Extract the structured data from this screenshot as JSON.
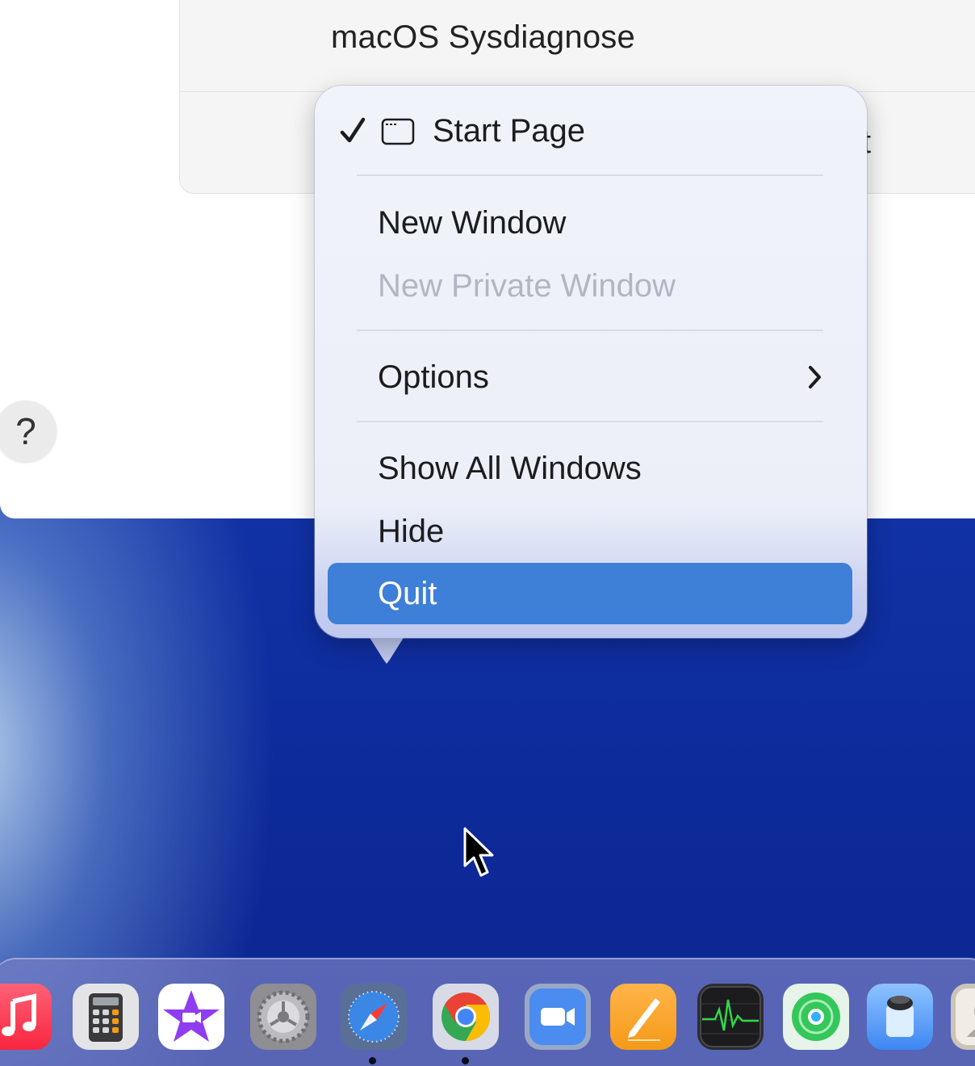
{
  "window": {
    "title": "macOS Sysdiagnose",
    "partial_text": "t",
    "help_label": "?"
  },
  "menu": {
    "start_page": {
      "label": "Start Page",
      "checked": true
    },
    "new_window": "New Window",
    "new_private_window": "New Private Window",
    "options": "Options",
    "show_all_windows": "Show All Windows",
    "hide": "Hide",
    "quit": "Quit"
  },
  "dock": {
    "apps": [
      {
        "name": "music-icon",
        "running": false
      },
      {
        "name": "calculator-icon",
        "running": false
      },
      {
        "name": "imovie-icon",
        "running": false
      },
      {
        "name": "system-settings-icon",
        "running": false
      },
      {
        "name": "safari-icon",
        "running": true
      },
      {
        "name": "chrome-icon",
        "running": true
      },
      {
        "name": "zoom-icon",
        "running": false
      },
      {
        "name": "pages-icon",
        "running": false
      },
      {
        "name": "activity-monitor-icon",
        "running": false
      },
      {
        "name": "find-my-icon",
        "running": false
      },
      {
        "name": "preview-icon",
        "running": false
      },
      {
        "name": "contacts-icon",
        "running": false
      }
    ]
  },
  "colors": {
    "menu_highlight": "#3e7fd8",
    "wallpaper": "#0e2a96",
    "disabled_text": "#b3b6c2"
  }
}
